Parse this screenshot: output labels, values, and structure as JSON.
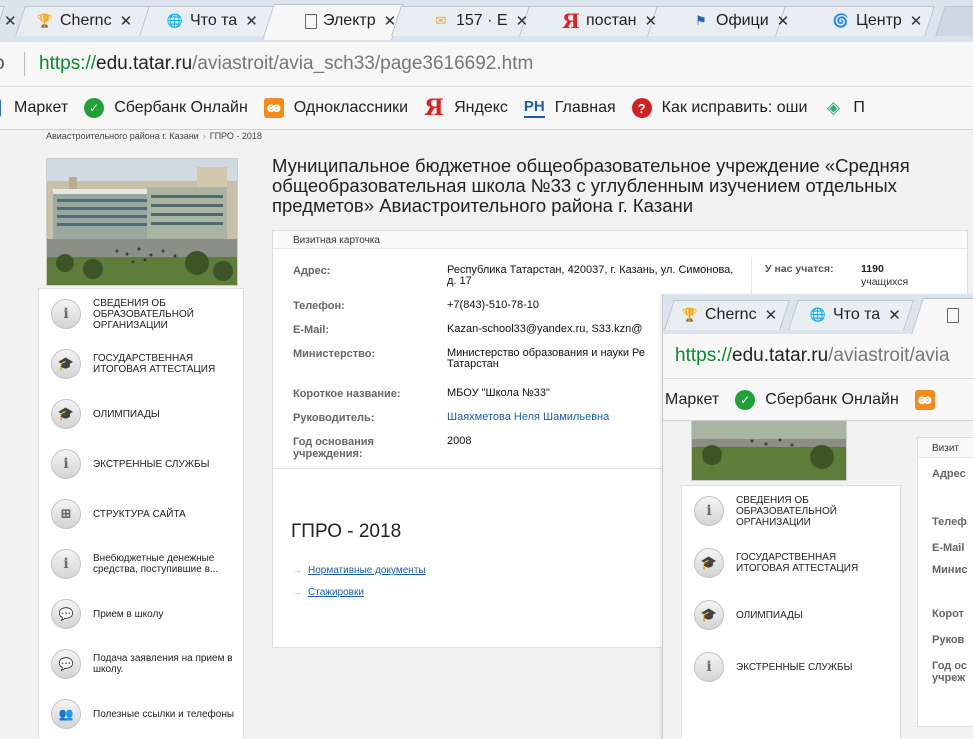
{
  "tabs": [
    {
      "label": "Chernc",
      "icon": "trophy-icon",
      "icon_color": "#f2b41c"
    },
    {
      "label": "Что та",
      "icon": "globe-icon",
      "icon_color": "#3a8dd8"
    },
    {
      "label": "Электр",
      "icon": "page-icon",
      "icon_color": "#777777"
    },
    {
      "label": "157 · E",
      "icon": "mail-icon",
      "icon_color": "#f5a51a"
    },
    {
      "label": "постан",
      "icon": "yandex-icon",
      "icon_color": "#e02020"
    },
    {
      "label": "Офици",
      "icon": "flag-icon",
      "icon_color": "#1e63c6"
    },
    {
      "label": "Центр",
      "icon": "swirl-icon",
      "icon_color": "#6a4bc4"
    }
  ],
  "address": {
    "prefix": "o",
    "scheme": "https://",
    "host": "edu.tatar.ru",
    "path": "/aviastroit/avia_sch33/page3616692.htm"
  },
  "bookmarks": [
    {
      "label": "Маркет",
      "icon": "market-icon",
      "icon_color": "#2a6fd6"
    },
    {
      "label": "Сбербанк Онлайн",
      "icon": "sberbank-icon",
      "icon_color": "#21a038"
    },
    {
      "label": "Одноклассники",
      "icon": "odnoklassniki-icon",
      "icon_color": "#f28a1d"
    },
    {
      "label": "Яндекс",
      "icon": "yandex-icon",
      "icon_color": "#e02020"
    },
    {
      "label": "Главная",
      "icon": "rh-icon",
      "icon_color": "#1d5aa8",
      "icon_text": "РН"
    },
    {
      "label": "Как исправить: оши",
      "icon": "help-icon",
      "icon_color": "#d42020"
    },
    {
      "label": "П",
      "icon": "gem-icon",
      "icon_color": "#2bb36b"
    }
  ],
  "breadcrumb": {
    "parent": "Авиастроительного района г. Казани",
    "separator": "›",
    "current": "ГПРО - 2018"
  },
  "page_title": "Муниципальное бюджетное общеобразовательное учреждение «Средняя общеобразовательная школа №33 с углубленным изучением отдельных предметов» Авиастроительного района г. Казани",
  "menu": [
    {
      "label": "СВЕДЕНИЯ ОБ ОБРАЗОВАТЕЛЬНОЙ ОРГАНИЗАЦИИ",
      "icon": "info-icon",
      "glyph": "i"
    },
    {
      "label": "ГОСУДАРСТВЕННАЯ ИТОГОВАЯ АТТЕСТАЦИЯ",
      "icon": "graduation-cap-icon",
      "glyph": "🎓"
    },
    {
      "label": "ОЛИМПИАДЫ",
      "icon": "graduation-cap-icon",
      "glyph": "🎓"
    },
    {
      "label": "ЭКСТРЕННЫЕ СЛУЖБЫ",
      "icon": "info-icon",
      "glyph": "i"
    },
    {
      "label": "СТРУКТУРА САЙТА",
      "icon": "sitemap-icon",
      "glyph": "⊞"
    },
    {
      "label": "Внебюджетные денежные средства, поступившие в...",
      "icon": "info-icon",
      "glyph": "i"
    },
    {
      "label": "Прием в школу",
      "icon": "chat-icon",
      "glyph": "💬"
    },
    {
      "label": "Подача заявления на прием в школу.",
      "icon": "chat-icon",
      "glyph": "💬"
    },
    {
      "label": "Полезные ссылки и телефоны",
      "icon": "group-icon",
      "glyph": "👥"
    }
  ],
  "card": {
    "header": "Визитная карточка",
    "rows": [
      {
        "key": "Адрес:",
        "value": "Республика Татарстан, 420037, г. Казань, ул. Симонова, д. 17"
      },
      {
        "key": "Телефон:",
        "value": "+7(843)-510-78-10"
      },
      {
        "key": "E-Mail:",
        "value": "Kazan-school33@yandex.ru, S33.kzn@"
      },
      {
        "key": "Министерство:",
        "value": "Министерство образования и науки Ре Татарстан"
      },
      {
        "key": "Короткое название:",
        "value": "МБОУ \"Школа №33\""
      },
      {
        "key": "Руководитель:",
        "value": "Шаяхметова Неля Шамильевна"
      },
      {
        "key": "Год основания учреждения:",
        "value": "2008"
      }
    ],
    "stat": {
      "label": "У нас учатся:",
      "value": "1190",
      "unit": "учащихся"
    }
  },
  "gpro": {
    "title": "ГПРО - 2018",
    "links": [
      "Нормативные документы",
      "Стажировки"
    ]
  },
  "overlay": {
    "tabs": [
      {
        "label": "Chernc",
        "icon": "trophy-icon",
        "icon_color": "#f2b41c"
      },
      {
        "label": "Что та",
        "icon": "globe-icon",
        "icon_color": "#3a8dd8"
      },
      {
        "label": "",
        "icon": "page-icon",
        "icon_color": "#777777"
      }
    ],
    "url_scheme": "https://",
    "url_host": "edu.tatar.ru",
    "url_path": "/aviastroit/avia",
    "bookmarks": [
      {
        "label": "Маркет",
        "icon": "market-icon"
      },
      {
        "label": "Сбербанк Онлайн",
        "icon": "sberbank-icon",
        "icon_color": "#21a038"
      },
      {
        "label": "",
        "icon": "odnoklassniki-icon",
        "icon_color": "#f28a1d"
      }
    ],
    "card_header": "Визит",
    "card_keys": [
      "Адрес",
      "Телеф",
      "E-Mail",
      "Минис",
      "Корот",
      "Руков",
      "Год ос учреж"
    ],
    "menu": [
      {
        "label": "СВЕДЕНИЯ ОБ ОБРАЗОВАТЕЛЬНОЙ ОРГАНИЗАЦИИ",
        "icon": "info-icon",
        "glyph": "i"
      },
      {
        "label": "ГОСУДАРСТВЕННАЯ ИТОГОВАЯ АТТЕСТАЦИЯ",
        "icon": "graduation-cap-icon",
        "glyph": "🎓"
      },
      {
        "label": "ОЛИМПИАДЫ",
        "icon": "graduation-cap-icon",
        "glyph": "🎓"
      },
      {
        "label": "ЭКСТРЕННЫЕ СЛУЖБЫ",
        "icon": "info-icon",
        "glyph": "i"
      }
    ]
  }
}
